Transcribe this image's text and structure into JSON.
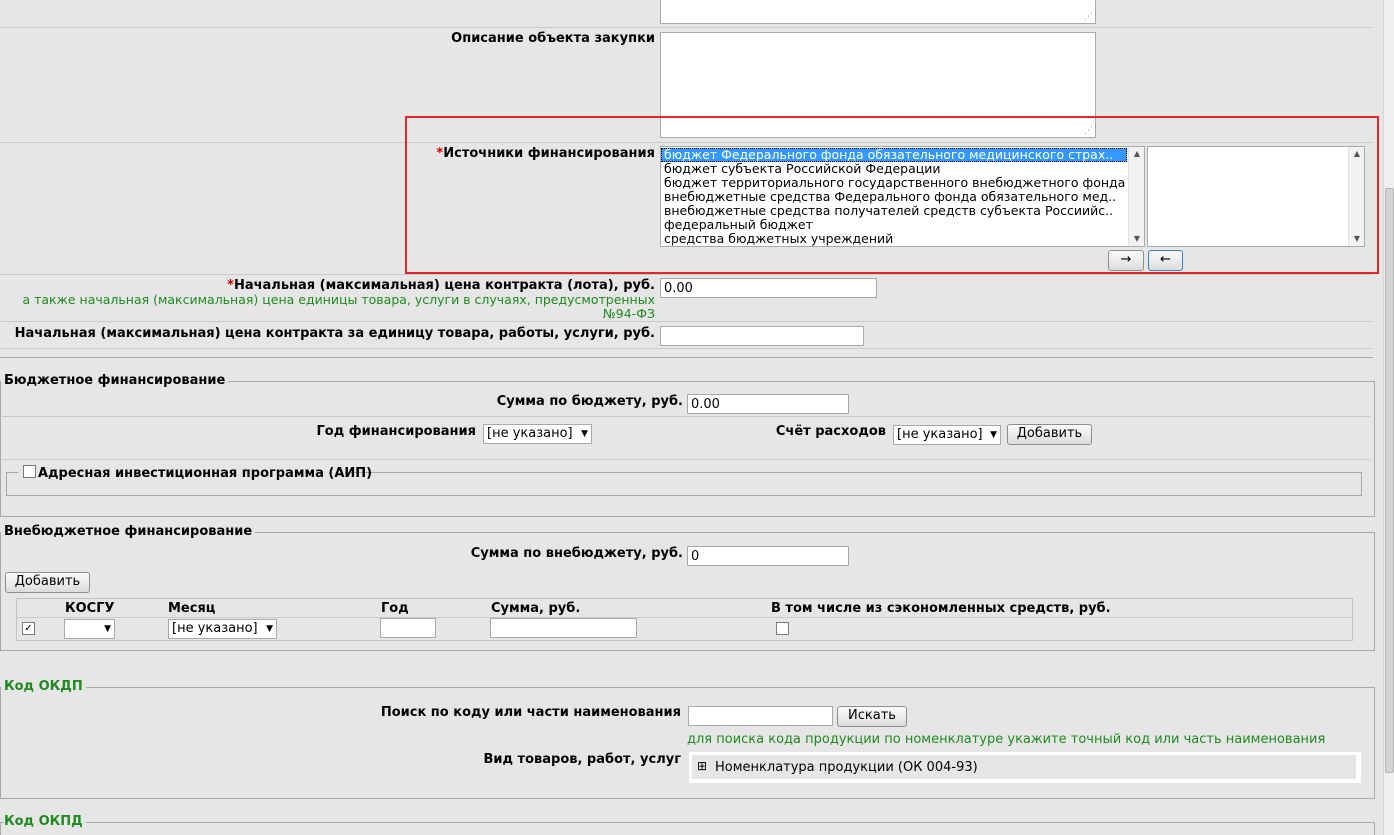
{
  "purchase": {
    "description_label": "Описание объекта закупки",
    "funding_sources": {
      "label": "Источники финансирования",
      "required_mark": "*",
      "options": [
        "бюджет Федерального фонда обязательного медицинского страх..",
        "бюджет субъекта Российской Федерации",
        "бюджет территориального государственного внебюджетного фонда",
        "внебюджетные средства Федерального фонда обязательного мед..",
        "внебюджетные средства получателей средств субъекта Россиийс..",
        "федеральный бюджет",
        "средства бюджетных учреждений"
      ],
      "selected_index": 0,
      "add_button": "→",
      "remove_button": "←"
    },
    "max_price": {
      "required_mark": "*",
      "label": "Начальная (максимальная) цена контракта (лота), руб.",
      "hint_line1": "а также начальная (максимальная) цена единицы товара, услуги в случаях, предусмотренных",
      "hint_line2": "№94-ФЗ",
      "value": "0.00"
    },
    "unit_price": {
      "label": "Начальная (максимальная) цена контракта за единицу товара, работы, услуги, руб.",
      "value": ""
    }
  },
  "budget": {
    "legend": "Бюджетное финансирование",
    "sum_label": "Сумма по бюджету, руб.",
    "sum_value": "0.00",
    "year_label": "Год финансирования",
    "year_value": "[не указано]",
    "account_label": "Счёт расходов",
    "account_value": "[не указано]",
    "add_button": "Добавить",
    "aip_label": "Адресная инвестиционная программа (АИП)"
  },
  "offbudget": {
    "legend": "Внебюджетное финансирование",
    "sum_label": "Сумма по внебюджету, руб.",
    "sum_value": "0",
    "add_button": "Добавить",
    "columns": [
      "КОСГУ",
      "Месяц",
      "Год",
      "Сумма, руб.",
      "В том числе из сэкономленных средств, руб."
    ],
    "row": {
      "checked": true,
      "kosgu": "",
      "month": "[не указано]",
      "year": "",
      "sum": "",
      "saved_checked": false
    }
  },
  "okdp": {
    "legend": "Код ОКДП",
    "search_label": "Поиск по коду или части наименования",
    "search_value": "",
    "search_button": "Искать",
    "hint": "для поиска кода продукции по номенклатуре укажите точный код или часть наименования",
    "type_label": "Вид товаров, работ, услуг",
    "tree_expand": "⊞",
    "tree_item": "Номенклатура продукции (ОК 004-93)"
  },
  "okpd": {
    "legend": "Код ОКПД"
  },
  "colors": {
    "background": "#e6e6e6",
    "highlight_box": "#e2262b",
    "hint_green": "#1f8a1f",
    "selection": "#3399ff"
  }
}
